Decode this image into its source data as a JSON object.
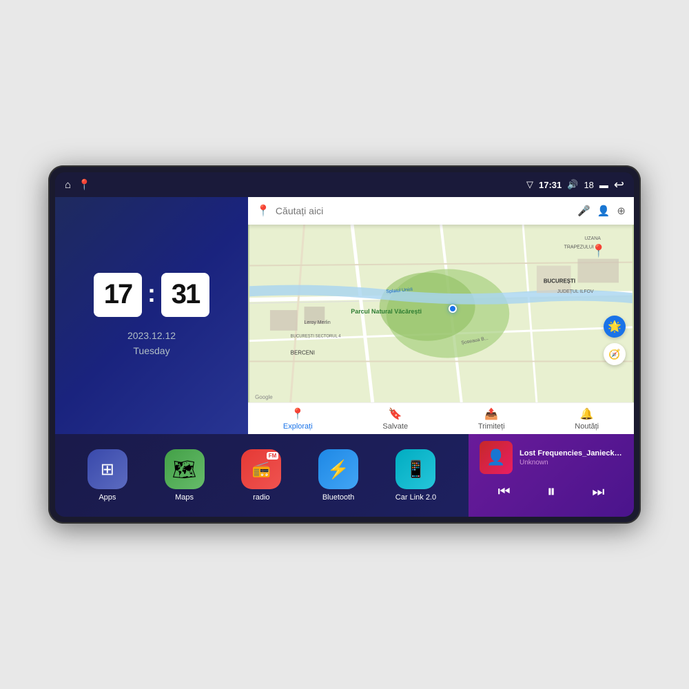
{
  "device": {
    "status_bar": {
      "signal_icon": "▽",
      "time": "17:31",
      "volume_icon": "🔊",
      "battery_level": "18",
      "battery_icon": "🔋",
      "back_icon": "↩"
    },
    "clock": {
      "hours": "17",
      "minutes": "31",
      "date": "2023.12.12",
      "day": "Tuesday"
    },
    "map": {
      "search_placeholder": "Căutați aici",
      "bottom_items": [
        {
          "icon": "📍",
          "label": "Explorați",
          "active": true
        },
        {
          "icon": "🔖",
          "label": "Salvate",
          "active": false
        },
        {
          "icon": "📤",
          "label": "Trimiteți",
          "active": false
        },
        {
          "icon": "🔔",
          "label": "Noutăți",
          "active": false
        }
      ],
      "locations": [
        "Parcul Natural Văcărești",
        "Leroy Merlin",
        "BUCUREȘTI",
        "JUDEȚUL ILFOV",
        "BERCENI",
        "TRAPEZULUI",
        "BUCUREȘTI SECTORUL 4",
        "UZANA",
        "Splaiul Unirii",
        "Șoseaua B..."
      ]
    },
    "apps": [
      {
        "id": "apps",
        "label": "Apps",
        "icon": "⊞",
        "color_class": "icon-apps"
      },
      {
        "id": "maps",
        "label": "Maps",
        "icon": "🗺",
        "color_class": "icon-maps"
      },
      {
        "id": "radio",
        "label": "radio",
        "icon": "📻",
        "color_class": "icon-radio"
      },
      {
        "id": "bluetooth",
        "label": "Bluetooth",
        "icon": "🔵",
        "color_class": "icon-bluetooth"
      },
      {
        "id": "carlink",
        "label": "Car Link 2.0",
        "icon": "🔗",
        "color_class": "icon-carlink"
      }
    ],
    "music": {
      "title": "Lost Frequencies_Janieck Devy-...",
      "artist": "Unknown",
      "controls": {
        "prev": "⏮",
        "play_pause": "⏸",
        "next": "⏭"
      }
    }
  }
}
